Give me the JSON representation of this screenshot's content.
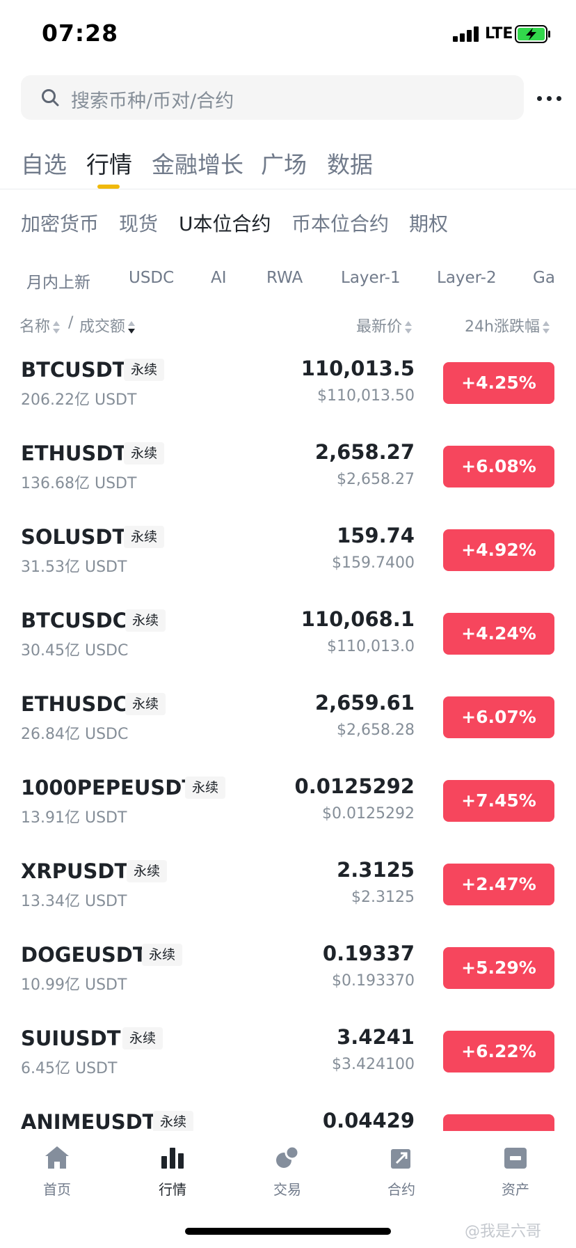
{
  "status_bar": {
    "time": "07:28",
    "network": "LTE"
  },
  "search": {
    "placeholder": "搜索币种/币对/合约"
  },
  "main_tabs": [
    "自选",
    "行情",
    "金融增长",
    "广场",
    "数据"
  ],
  "sub_tabs": [
    "加密货币",
    "现货",
    "U本位合约",
    "币本位合约",
    "期权"
  ],
  "filters": [
    "月内上新",
    "USDC",
    "AI",
    "RWA",
    "Layer-1",
    "Layer-2",
    "Ga"
  ],
  "sort_header": {
    "name": "名称",
    "separator": "/",
    "volume": "成交额",
    "price": "最新价",
    "change": "24h涨跌幅"
  },
  "tokens": [
    {
      "symbol": "BTCUSDT",
      "tag": "永续",
      "volume": "206.22亿 USDT",
      "price": "110,013.5",
      "fiat": "$110,013.50",
      "change": "+4.25%"
    },
    {
      "symbol": "ETHUSDT",
      "tag": "永续",
      "volume": "136.68亿 USDT",
      "price": "2,658.27",
      "fiat": "$2,658.27",
      "change": "+6.08%"
    },
    {
      "symbol": "SOLUSDT",
      "tag": "永续",
      "volume": "31.53亿 USDT",
      "price": "159.74",
      "fiat": "$159.7400",
      "change": "+4.92%"
    },
    {
      "symbol": "BTCUSDC",
      "tag": "永续",
      "volume": "30.45亿 USDC",
      "price": "110,068.1",
      "fiat": "$110,013.0",
      "change": "+4.24%"
    },
    {
      "symbol": "ETHUSDC",
      "tag": "永续",
      "volume": "26.84亿 USDC",
      "price": "2,659.61",
      "fiat": "$2,658.28",
      "change": "+6.07%"
    },
    {
      "symbol": "1000PEPEUSDT",
      "tag": "永续",
      "volume": "13.91亿 USDT",
      "price": "0.0125292",
      "fiat": "$0.0125292",
      "change": "+7.45%"
    },
    {
      "symbol": "XRPUSDT",
      "tag": "永续",
      "volume": "13.34亿 USDT",
      "price": "2.3125",
      "fiat": "$2.3125",
      "change": "+2.47%"
    },
    {
      "symbol": "DOGEUSDT",
      "tag": "永续",
      "volume": "10.99亿 USDT",
      "price": "0.19337",
      "fiat": "$0.193370",
      "change": "+5.29%"
    },
    {
      "symbol": "SUIUSDT",
      "tag": "永续",
      "volume": "6.45亿 USDT",
      "price": "3.4241",
      "fiat": "$3.424100",
      "change": "+6.22%"
    },
    {
      "symbol": "ANIMEUSDT",
      "tag": "永续",
      "volume": "",
      "price": "0.04429",
      "fiat": "",
      "change": ""
    }
  ],
  "bottom_nav": [
    {
      "label": "首页",
      "icon": "home-icon"
    },
    {
      "label": "行情",
      "icon": "markets-icon"
    },
    {
      "label": "交易",
      "icon": "trade-icon"
    },
    {
      "label": "合约",
      "icon": "futures-icon"
    },
    {
      "label": "资产",
      "icon": "wallet-icon"
    }
  ],
  "watermark": "@我是六哥",
  "colors": {
    "accent": "#f0b90b",
    "up": "#f6465d",
    "text": "#1e2329",
    "muted": "#858e98"
  }
}
